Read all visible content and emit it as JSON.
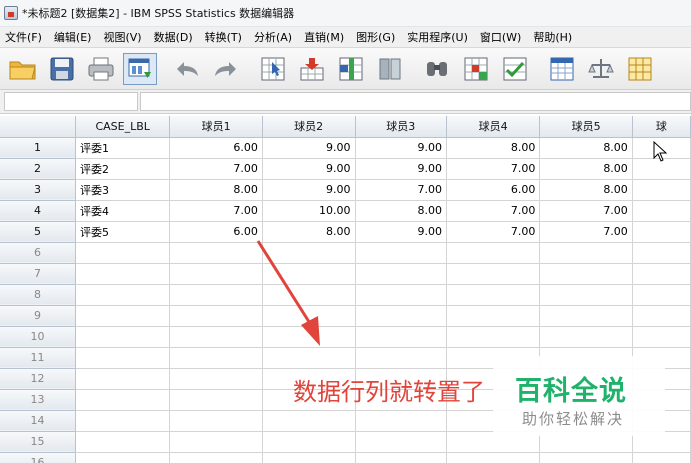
{
  "window": {
    "title": "*未标题2 [数据集2] - IBM SPSS Statistics 数据编辑器"
  },
  "menu": [
    "文件(F)",
    "编辑(E)",
    "视图(V)",
    "数据(D)",
    "转换(T)",
    "分析(A)",
    "直销(M)",
    "图形(G)",
    "实用程序(U)",
    "窗口(W)",
    "帮助(H)"
  ],
  "toolbar": {
    "icons": [
      "open-folder-icon",
      "save-icon",
      "print-icon",
      "dialog-recall-icon",
      "undo-icon",
      "redo-icon",
      "goto-case-icon",
      "insert-case-icon",
      "insert-variable-icon",
      "split-file-icon",
      "find-icon",
      "weight-cases-icon",
      "select-cases-icon",
      "value-labels-icon",
      "use-sets-icon",
      "grid-icon"
    ]
  },
  "grid": {
    "columns": [
      "CASE_LBL",
      "球员1",
      "球员2",
      "球员3",
      "球员4",
      "球员5",
      "球"
    ],
    "rows": [
      {
        "num": "1",
        "cells": [
          "评委1",
          "6.00",
          "9.00",
          "9.00",
          "8.00",
          "8.00"
        ]
      },
      {
        "num": "2",
        "cells": [
          "评委2",
          "7.00",
          "9.00",
          "9.00",
          "7.00",
          "8.00"
        ]
      },
      {
        "num": "3",
        "cells": [
          "评委3",
          "8.00",
          "9.00",
          "7.00",
          "6.00",
          "8.00"
        ]
      },
      {
        "num": "4",
        "cells": [
          "评委4",
          "7.00",
          "10.00",
          "8.00",
          "7.00",
          "7.00"
        ]
      },
      {
        "num": "5",
        "cells": [
          "评委5",
          "6.00",
          "8.00",
          "9.00",
          "7.00",
          "7.00"
        ]
      }
    ],
    "empty_row_numbers": [
      "6",
      "7",
      "8",
      "9",
      "10",
      "11",
      "12",
      "13",
      "14",
      "15",
      "16"
    ]
  },
  "annotation": {
    "caption": "数据行列就转置了"
  },
  "watermark": {
    "title": "百科全说",
    "subtitle": "助你轻松解决"
  },
  "colors": {
    "caption": "#e0443a",
    "watermark_title": "#1fb26a",
    "arrow": "#e0443a"
  }
}
